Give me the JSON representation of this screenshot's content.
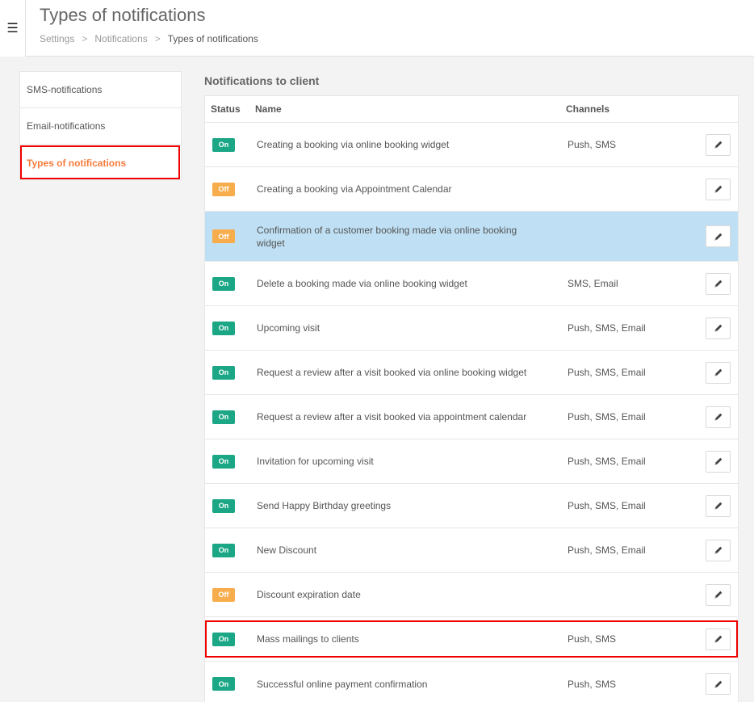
{
  "header": {
    "menu_icon": "hamburger-icon",
    "title": "Types of notifications",
    "breadcrumb": [
      "Settings",
      "Notifications",
      "Types of notifications"
    ],
    "separator": ">"
  },
  "sidebar": {
    "items": [
      {
        "label": "SMS-notifications"
      },
      {
        "label": "Email-notifications"
      },
      {
        "label": "Types of notifications",
        "active": true
      }
    ],
    "active_color": "#f47b3c"
  },
  "section": {
    "title": "Notifications to client",
    "columns": {
      "status": "Status",
      "name": "Name",
      "channels": "Channels"
    }
  },
  "colors": {
    "on": "#1ba785",
    "off": "#f8ad4c",
    "selected_row": "#bfe0f4",
    "highlight": "#e00000"
  },
  "rows": [
    {
      "status": "On",
      "name": "Creating a booking via online booking widget",
      "channels": "Push, SMS"
    },
    {
      "status": "Off",
      "name": "Creating a booking via Appointment Calendar",
      "channels": ""
    },
    {
      "status": "Off",
      "name": "Confirmation of a customer booking made via online booking widget",
      "channels": "",
      "selected": true
    },
    {
      "status": "On",
      "name": "Delete a booking made via online booking widget",
      "channels": "SMS, Email"
    },
    {
      "status": "On",
      "name": "Upcoming visit",
      "channels": "Push, SMS, Email"
    },
    {
      "status": "On",
      "name": "Request a review after a visit booked via online booking widget",
      "channels": "Push, SMS, Email"
    },
    {
      "status": "On",
      "name": "Request a review after a visit booked via appointment calendar",
      "channels": "Push, SMS, Email"
    },
    {
      "status": "On",
      "name": "Invitation for upcoming visit",
      "channels": "Push, SMS, Email"
    },
    {
      "status": "On",
      "name": "Send Happy Birthday greetings",
      "channels": "Push, SMS, Email"
    },
    {
      "status": "On",
      "name": "New Discount",
      "channels": "Push, SMS, Email"
    },
    {
      "status": "Off",
      "name": "Discount expiration date",
      "channels": ""
    },
    {
      "status": "On",
      "name": "Mass mailings to clients",
      "channels": "Push, SMS",
      "highlighted": true
    },
    {
      "status": "On",
      "name": "Successful online payment confirmation",
      "channels": "Push, SMS"
    }
  ]
}
